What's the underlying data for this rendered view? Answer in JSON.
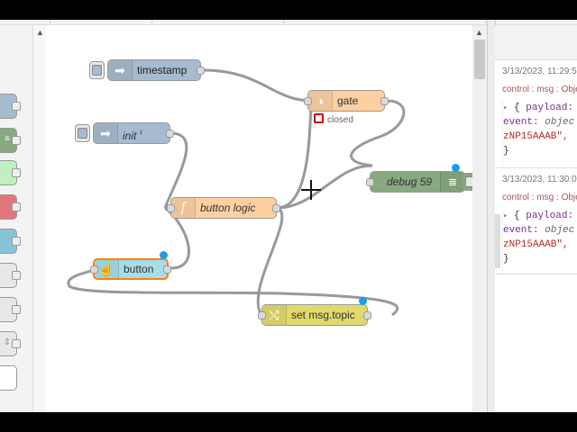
{
  "palette": {
    "colors": [
      "#a6bbcf",
      "#87a980",
      "#c0f0c0",
      "#e2767c",
      "#87c3d8",
      "#e8e8e8",
      "#e8e8e8",
      "#e8e8e8",
      "#ffffff"
    ],
    "scroll_up_glyph": "▲"
  },
  "workspace": {
    "nodes": {
      "timestamp": {
        "label": "timestamp",
        "color": "#a6bbcf"
      },
      "init": {
        "label": "init",
        "suffix": "¹",
        "color": "#a6bbcf"
      },
      "gate": {
        "label": "gate",
        "color": "#fdd0a2",
        "status": "closed"
      },
      "debug": {
        "label": "debug 59",
        "color": "#87a980"
      },
      "button_logic": {
        "label": "button logic",
        "color": "#fdd0a2"
      },
      "button": {
        "label": "button",
        "color": "#a6dde8"
      },
      "set_topic": {
        "label": "set msg.topic",
        "color": "#e2d96e"
      }
    },
    "icons": {
      "inject": "inject-arrow-icon",
      "function": "f",
      "gate": "gate-icon",
      "debug": "debug-bars-icon",
      "button": "hand-icon",
      "change": "shuffle-icon"
    },
    "scroll_up_glyph": "▲"
  },
  "sidebar": {
    "messages": [
      {
        "time": "3/13/2023, 11:29:5",
        "source": "control : msg : Obje",
        "line1_key": "payload:",
        "line2_key": "event:",
        "line2_val": "objec",
        "line3": "zNP15AAAB\","
      },
      {
        "time": "3/13/2023, 11:30:0",
        "source": "control : msg : Obje",
        "line1_key": "payload:",
        "line2_key": "event:",
        "line2_val": "objec",
        "line3": "zNP15AAAB\","
      }
    ],
    "expander_glyph": "▸",
    "brace_open": "{",
    "brace_close": "}"
  }
}
